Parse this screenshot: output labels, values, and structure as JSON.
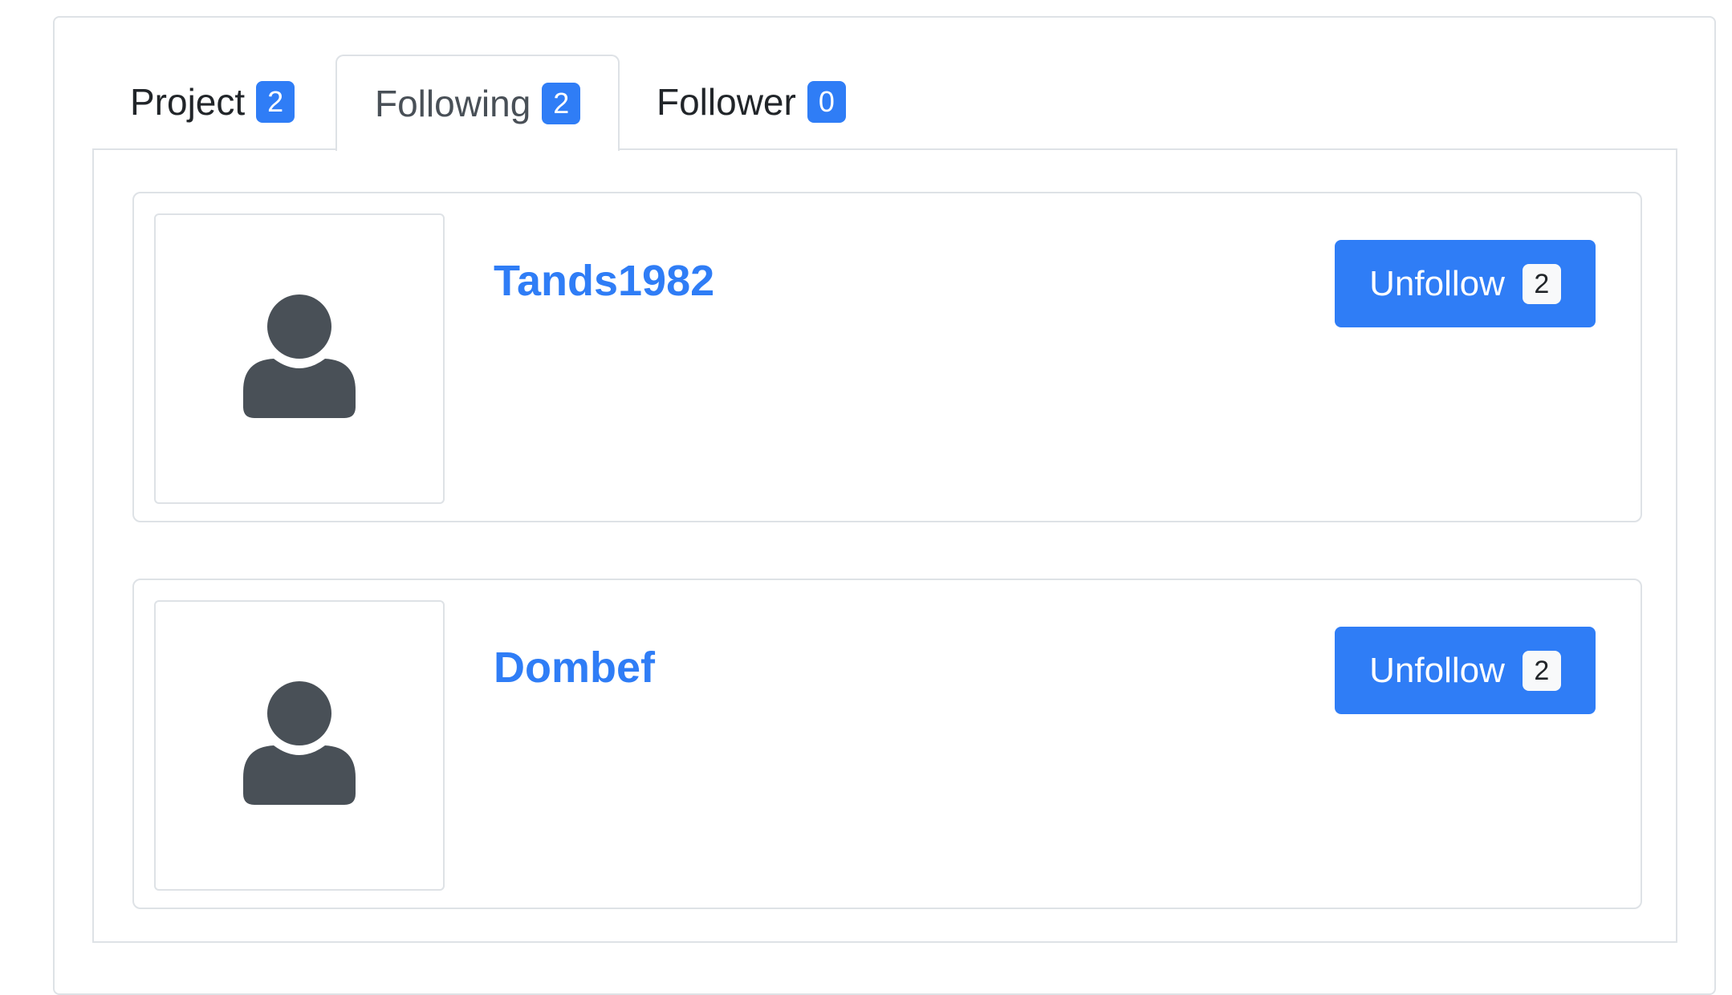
{
  "tabs": [
    {
      "label": "Project",
      "count": "2"
    },
    {
      "label": "Following",
      "count": "2"
    },
    {
      "label": "Follower",
      "count": "0"
    }
  ],
  "following": [
    {
      "username": "Tands1982",
      "button_label": "Unfollow",
      "button_count": "2",
      "avatar_icon": "user-icon"
    },
    {
      "username": "Dombef",
      "button_label": "Unfollow",
      "button_count": "2",
      "avatar_icon": "user-icon"
    }
  ],
  "colors": {
    "accent": "#2f7df6",
    "avatar": "#495057",
    "border": "#dee2e6"
  }
}
